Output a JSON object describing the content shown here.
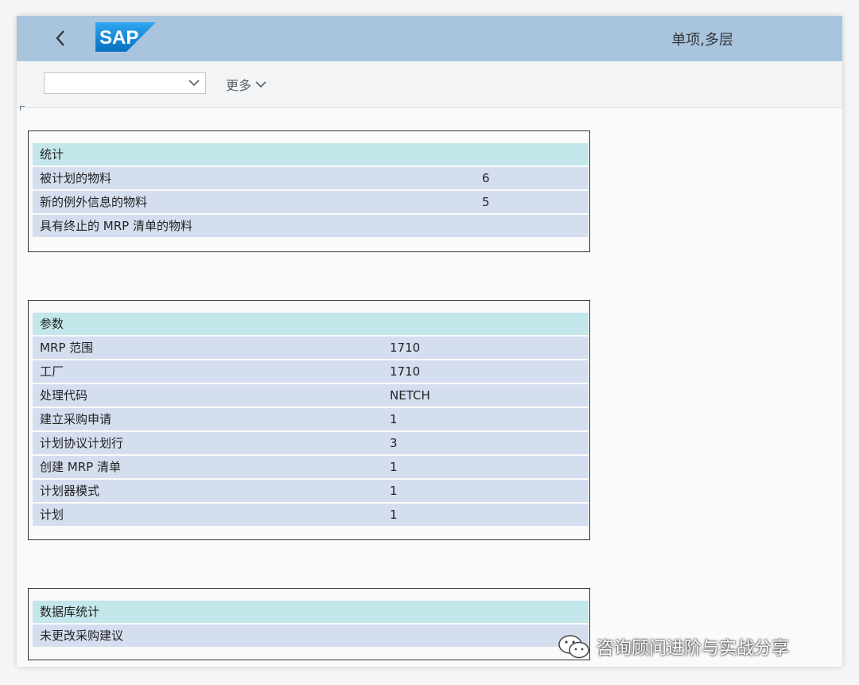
{
  "shell": {
    "logo_text": "SAP",
    "title": "单项,多层"
  },
  "toolbar": {
    "select_value": "",
    "more_label": "更多"
  },
  "statistics": {
    "header": "统计",
    "rows": [
      {
        "label": "被计划的物料",
        "value": "6"
      },
      {
        "label": "新的例外信息的物料",
        "value": "5"
      },
      {
        "label": "具有终止的 MRP 清单的物料",
        "value": ""
      }
    ]
  },
  "parameters": {
    "header": "参数",
    "rows": [
      {
        "label": "MRP 范围",
        "value": "1710"
      },
      {
        "label": "工厂",
        "value": "1710"
      },
      {
        "label": "处理代码",
        "value": "NETCH"
      },
      {
        "label": "建立采购申请",
        "value": "1"
      },
      {
        "label": "计划协议计划行",
        "value": "3"
      },
      {
        "label": "创建 MRP 清单",
        "value": "1"
      },
      {
        "label": "计划器模式",
        "value": "1"
      },
      {
        "label": "计划",
        "value": "1"
      }
    ]
  },
  "database_statistics": {
    "header": "数据库统计",
    "rows": [
      {
        "label": "未更改采购建议",
        "value": ""
      }
    ]
  },
  "watermark": {
    "text": "咨询顾问进阶与实战分享"
  },
  "colors": {
    "shell_bg": "#a9c4dd",
    "row_bg": "#d5deef",
    "header_row_bg": "#c3e7ea",
    "sap_blue": "#1a8fd8"
  }
}
